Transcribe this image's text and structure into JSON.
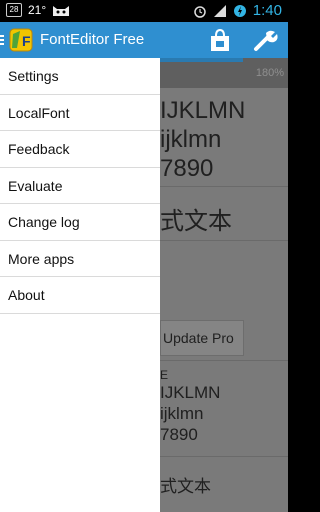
{
  "status_bar": {
    "calendar_day": "28",
    "temperature": "21°",
    "time": "1:40",
    "left_icons": [
      "calendar-icon",
      "cat-face-icon"
    ],
    "right_icons": [
      "alarm-icon",
      "signal-icon",
      "battery-icon"
    ]
  },
  "action_bar": {
    "title": "FontEditor Free",
    "logo_text": "F",
    "icons": [
      "drawer-toggle-icon",
      "app-logo-icon",
      "shopping-bag-icon",
      "wrench-icon"
    ],
    "accent_color": "#2f8fd0"
  },
  "drawer": {
    "items": [
      {
        "label": "Settings"
      },
      {
        "label": "LocalFont"
      },
      {
        "label": "Feedback"
      },
      {
        "label": "Evaluate"
      },
      {
        "label": "Change log"
      },
      {
        "label": "More apps"
      },
      {
        "label": "About"
      }
    ]
  },
  "background": {
    "progress_percent": "180%",
    "progress_fraction": 0.65,
    "sample_large": [
      "IJKLMN",
      "ijklmn",
      "7890"
    ],
    "cjk_large": "式文本",
    "update_button": "Update Pro",
    "sample_small_prefix": "E",
    "sample_small": [
      "IJKLMN",
      "ijklmn",
      "7890"
    ],
    "cjk_small": "式文本"
  }
}
